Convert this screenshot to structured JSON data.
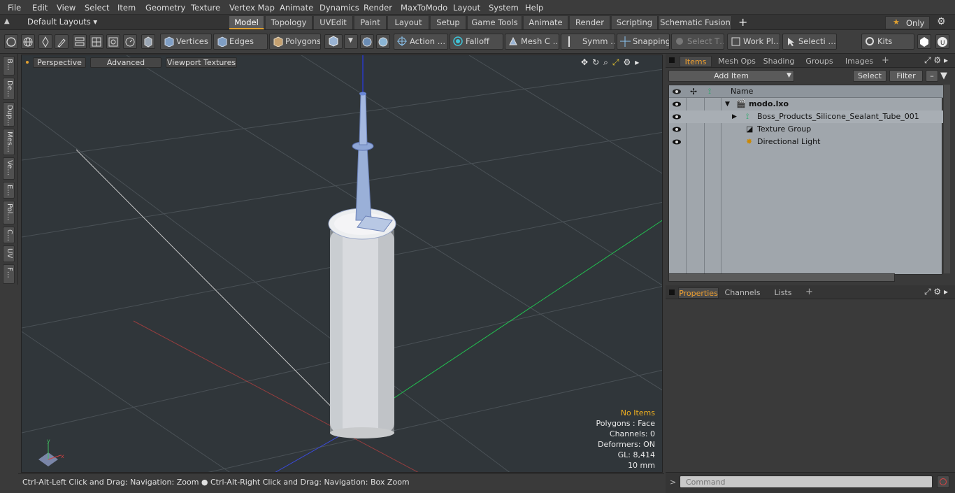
{
  "menu": [
    "File",
    "Edit",
    "View",
    "Select",
    "Item",
    "Geometry",
    "Texture",
    "Vertex Map",
    "Animate",
    "Dynamics",
    "Render",
    "MaxToModo",
    "Layout",
    "System",
    "Help"
  ],
  "layouts": {
    "label": "Default Layouts ▾"
  },
  "tabs": [
    "Model",
    "Topology",
    "UVEdit",
    "Paint",
    "Layout",
    "Setup",
    "Game Tools",
    "Animate",
    "Render",
    "Scripting",
    "Schematic Fusion"
  ],
  "tabs_active": "Model",
  "only_label": "Only",
  "toolbar": {
    "vertices": "Vertices",
    "edges": "Edges",
    "polygons": "Polygons",
    "action": "Action …",
    "falloff": "Falloff",
    "meshc": "Mesh C …",
    "symm": "Symm …",
    "snapping": "Snapping",
    "selectt": "Select T…",
    "workpl": "Work Pl…",
    "selecti": "Selecti …",
    "kits": "Kits"
  },
  "left_tabs": [
    "B…",
    "De…",
    "Dup…",
    "Mes…",
    "Ve…",
    "E…",
    "Pol…",
    "C…",
    "UV",
    "F…"
  ],
  "viewport": {
    "perspective": "Perspective",
    "advanced": "Advanced",
    "textures": "Viewport Textures",
    "hud": {
      "no_items": "No Items",
      "polygons": "Polygons : Face",
      "channels": "Channels: 0",
      "deformers": "Deformers: ON",
      "gl": "GL: 8,414",
      "scale": "10 mm"
    }
  },
  "status": {
    "hint": "Ctrl-Alt-Left Click and Drag: Navigation: Zoom ● Ctrl-Alt-Right Click and Drag: Navigation: Box Zoom"
  },
  "panel": {
    "tabs": [
      "Items",
      "Mesh Ops",
      "Shading",
      "Groups",
      "Images"
    ],
    "add_item": "Add Item",
    "select": "Select",
    "filter": "Filter",
    "name_col": "Name",
    "items": [
      {
        "name": "modo.lxo"
      },
      {
        "name": "Boss_Products_Silicone_Sealant_Tube_001"
      },
      {
        "name": "Texture Group"
      },
      {
        "name": "Directional Light"
      }
    ],
    "bottom_tabs": [
      "Properties",
      "Channels",
      "Lists"
    ],
    "command_placeholder": "Command"
  },
  "colors": {
    "accent": "#e0a030",
    "viewport_bg": "#30363a",
    "list_bg": "#a0a6ac"
  }
}
